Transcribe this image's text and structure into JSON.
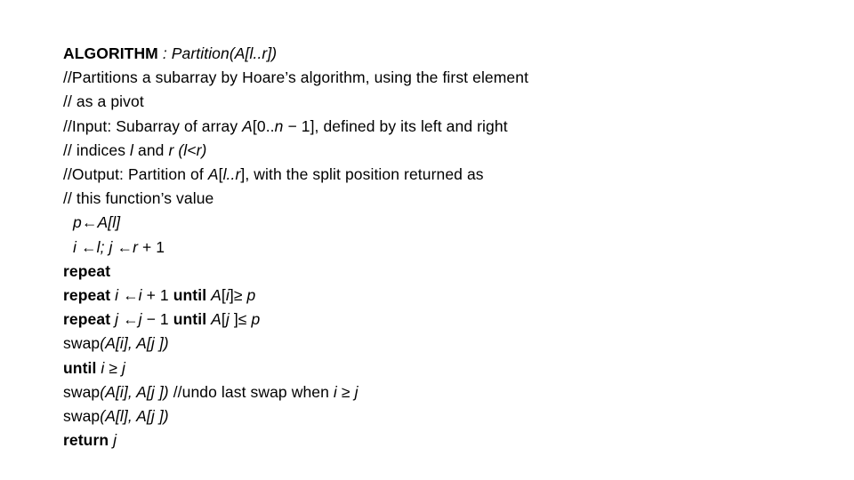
{
  "document": {
    "title": "ALGORITHM : Partition(A[l..r])",
    "background_color": "#ffffff",
    "text_color": "#000000",
    "lines": [
      {
        "id": "line-algorithm-header",
        "indent": 0,
        "segments": [
          {
            "text": "ALGORITHM",
            "style": "b"
          },
          {
            "text": " : ",
            "style": "i"
          },
          {
            "text": "Partition(A[l..r])",
            "style": "i"
          }
        ]
      },
      {
        "id": "line-comment-partitions",
        "indent": 0,
        "segments": [
          {
            "text": "//Partitions a subarray by Hoare’s algorithm, using the first element",
            "style": "n"
          }
        ]
      },
      {
        "id": "line-comment-pivot",
        "indent": 0,
        "segments": [
          {
            "text": "// as a pivot",
            "style": "n"
          }
        ]
      },
      {
        "id": "line-comment-input",
        "indent": 0,
        "segments": [
          {
            "text": "//Input: Subarray of array ",
            "style": "n"
          },
          {
            "text": "A",
            "style": "i"
          },
          {
            "text": "[0..",
            "style": "n"
          },
          {
            "text": "n",
            "style": "i"
          },
          {
            "text": " − 1], defined by its left and right",
            "style": "n"
          }
        ]
      },
      {
        "id": "line-comment-indices",
        "indent": 0,
        "segments": [
          {
            "text": "// indices ",
            "style": "n"
          },
          {
            "text": "l",
            "style": "i"
          },
          {
            "text": " and ",
            "style": "n"
          },
          {
            "text": "r (l<r)",
            "style": "i"
          }
        ]
      },
      {
        "id": "line-comment-output",
        "indent": 0,
        "segments": [
          {
            "text": "//Output: Partition of ",
            "style": "n"
          },
          {
            "text": "A",
            "style": "i"
          },
          {
            "text": "[",
            "style": "n"
          },
          {
            "text": "l..r",
            "style": "i"
          },
          {
            "text": "], with the split position returned as",
            "style": "n"
          }
        ]
      },
      {
        "id": "line-comment-function-value",
        "indent": 0,
        "segments": [
          {
            "text": "// this function’s value",
            "style": "n"
          }
        ]
      },
      {
        "id": "line-assign-pivot",
        "indent": 1,
        "segments": [
          {
            "text": "p",
            "style": "i"
          },
          {
            "text": "←",
            "style": "n"
          },
          {
            "text": "A",
            "style": "i"
          },
          {
            "text": "[",
            "style": "i"
          },
          {
            "text": "l",
            "style": "i"
          },
          {
            "text": "]",
            "style": "i"
          }
        ]
      },
      {
        "id": "line-assign-indices",
        "indent": 1,
        "segments": [
          {
            "text": "i ",
            "style": "i"
          },
          {
            "text": "←",
            "style": "n"
          },
          {
            "text": "l",
            "style": "i"
          },
          {
            "text": "; ",
            "style": "i"
          },
          {
            "text": "j ",
            "style": "i"
          },
          {
            "text": "←",
            "style": "n"
          },
          {
            "text": "r",
            "style": "i"
          },
          {
            "text": " + 1",
            "style": "n"
          }
        ]
      },
      {
        "id": "line-repeat-outer",
        "indent": 0,
        "segments": [
          {
            "text": "repeat",
            "style": "b"
          }
        ]
      },
      {
        "id": "line-repeat-i",
        "indent": 0,
        "segments": [
          {
            "text": "repeat",
            "style": "b"
          },
          {
            "text": " ",
            "style": "n"
          },
          {
            "text": "i ",
            "style": "i"
          },
          {
            "text": "←",
            "style": "n"
          },
          {
            "text": "i",
            "style": "i"
          },
          {
            "text": " + 1 ",
            "style": "n"
          },
          {
            "text": "until",
            "style": "b"
          },
          {
            "text": " ",
            "style": "n"
          },
          {
            "text": "A",
            "style": "i"
          },
          {
            "text": "[",
            "style": "n"
          },
          {
            "text": "i",
            "style": "i"
          },
          {
            "text": "]≥ ",
            "style": "n"
          },
          {
            "text": "p",
            "style": "i"
          }
        ]
      },
      {
        "id": "line-repeat-j",
        "indent": 0,
        "segments": [
          {
            "text": "repeat",
            "style": "b"
          },
          {
            "text": " ",
            "style": "n"
          },
          {
            "text": "j ",
            "style": "i"
          },
          {
            "text": "←",
            "style": "n"
          },
          {
            "text": "j",
            "style": "i"
          },
          {
            "text": " − 1 ",
            "style": "n"
          },
          {
            "text": "until",
            "style": "b"
          },
          {
            "text": " ",
            "style": "n"
          },
          {
            "text": "A",
            "style": "i"
          },
          {
            "text": "[",
            "style": "n"
          },
          {
            "text": "j",
            "style": "i"
          },
          {
            "text": " ]≤ ",
            "style": "n"
          },
          {
            "text": "p",
            "style": "i"
          }
        ]
      },
      {
        "id": "line-swap-inner",
        "indent": 0,
        "segments": [
          {
            "text": "swap",
            "style": "n"
          },
          {
            "text": "(A[i], A[j ])",
            "style": "i"
          }
        ]
      },
      {
        "id": "line-until-outer",
        "indent": 0,
        "segments": [
          {
            "text": "until",
            "style": "b"
          },
          {
            "text": " ",
            "style": "n"
          },
          {
            "text": "i",
            "style": "i"
          },
          {
            "text": " ≥ ",
            "style": "n"
          },
          {
            "text": "j",
            "style": "i"
          }
        ]
      },
      {
        "id": "line-swap-undo",
        "indent": 0,
        "segments": [
          {
            "text": "swap",
            "style": "n"
          },
          {
            "text": "(A[i], A[j ])",
            "style": "i"
          },
          {
            "text": " //undo last swap when ",
            "style": "n"
          },
          {
            "text": "i",
            "style": "i"
          },
          {
            "text": " ≥ ",
            "style": "n"
          },
          {
            "text": "j",
            "style": "i"
          }
        ]
      },
      {
        "id": "line-swap-final",
        "indent": 0,
        "segments": [
          {
            "text": "swap",
            "style": "n"
          },
          {
            "text": "(A[l], A[j ])",
            "style": "i"
          }
        ]
      },
      {
        "id": "line-return",
        "indent": 0,
        "segments": [
          {
            "text": "return",
            "style": "b"
          },
          {
            "text": " ",
            "style": "n"
          },
          {
            "text": "j",
            "style": "i"
          }
        ]
      }
    ]
  }
}
